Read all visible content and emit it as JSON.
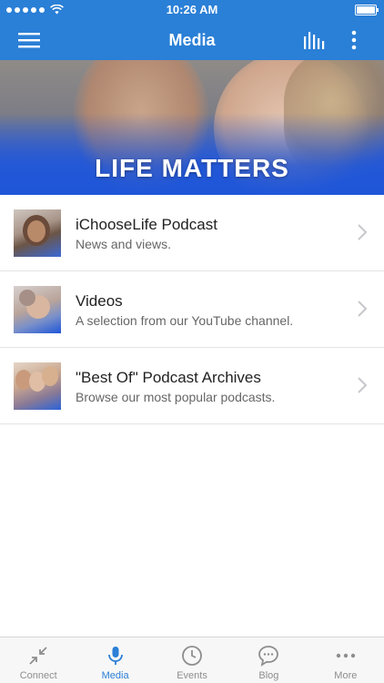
{
  "status_bar": {
    "time": "10:26 AM"
  },
  "nav": {
    "title": "Media"
  },
  "hero": {
    "title": "LIFE MATTERS"
  },
  "media_items": [
    {
      "title": "iChooseLife Podcast",
      "subtitle": "News and views."
    },
    {
      "title": "Videos",
      "subtitle": "A selection from our YouTube channel."
    },
    {
      "title": "\"Best Of\" Podcast Archives",
      "subtitle": "Browse our most popular podcasts."
    }
  ],
  "tabs": [
    {
      "label": "Connect",
      "icon": "compress-arrows-icon",
      "active": false
    },
    {
      "label": "Media",
      "icon": "microphone-icon",
      "active": true
    },
    {
      "label": "Events",
      "icon": "clock-icon",
      "active": false
    },
    {
      "label": "Blog",
      "icon": "speech-bubble-icon",
      "active": false
    },
    {
      "label": "More",
      "icon": "more-dots-icon",
      "active": false
    }
  ],
  "colors": {
    "brand": "#2a7fd6",
    "hero_blue": "#1f56d8",
    "inactive_tab": "#8e8e8e"
  }
}
